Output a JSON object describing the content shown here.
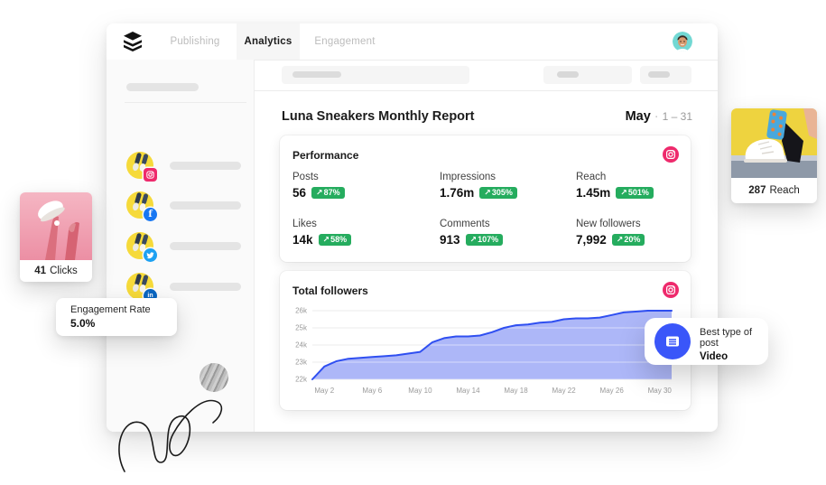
{
  "topbar": {
    "tabs": [
      {
        "label": "Publishing",
        "active": false
      },
      {
        "label": "Analytics",
        "active": true
      },
      {
        "label": "Engagement",
        "active": false
      }
    ]
  },
  "report_header": {
    "title": "Luna Sneakers Monthly Report",
    "month": "May",
    "separator": "·",
    "date_range": "1 – 31"
  },
  "performance_card": {
    "title": "Performance",
    "network": "instagram",
    "stats": [
      {
        "label": "Posts",
        "value": "56",
        "change": "87%"
      },
      {
        "label": "Impressions",
        "value": "1.76m",
        "change": "305%"
      },
      {
        "label": "Reach",
        "value": "1.45m",
        "change": "501%"
      },
      {
        "label": "Likes",
        "value": "14k",
        "change": "58%"
      },
      {
        "label": "Comments",
        "value": "913",
        "change": "107%"
      },
      {
        "label": "New followers",
        "value": "7,992",
        "change": "20%"
      }
    ]
  },
  "followers_card": {
    "title": "Total followers",
    "network": "instagram"
  },
  "chart_data": {
    "type": "area",
    "title": "Total followers",
    "x_unit": "day of May",
    "x": [
      1,
      2,
      3,
      4,
      5,
      6,
      7,
      8,
      9,
      10,
      11,
      12,
      13,
      14,
      15,
      16,
      17,
      18,
      19,
      20,
      21,
      22,
      23,
      24,
      25,
      26,
      27,
      28,
      29,
      30,
      31
    ],
    "values": [
      22000,
      22750,
      23050,
      23200,
      23250,
      23300,
      23350,
      23400,
      23500,
      23600,
      24150,
      24400,
      24500,
      24500,
      24550,
      24750,
      25000,
      25150,
      25200,
      25300,
      25350,
      25500,
      25550,
      25550,
      25600,
      25750,
      25900,
      25950,
      26000,
      26000,
      26000
    ],
    "ylim": [
      22000,
      26000
    ],
    "y_ticks": [
      {
        "value": 22000,
        "label": "22k"
      },
      {
        "value": 23000,
        "label": "23k"
      },
      {
        "value": 24000,
        "label": "24k"
      },
      {
        "value": 25000,
        "label": "25k"
      },
      {
        "value": 26000,
        "label": "26k"
      }
    ],
    "x_ticks": [
      {
        "day": 2,
        "label": "May 2"
      },
      {
        "day": 6,
        "label": "May 6"
      },
      {
        "day": 10,
        "label": "May 10"
      },
      {
        "day": 14,
        "label": "May 14"
      },
      {
        "day": 18,
        "label": "May 18"
      },
      {
        "day": 22,
        "label": "May 22"
      },
      {
        "day": 26,
        "label": "May 26"
      },
      {
        "day": 30,
        "label": "May 30"
      }
    ],
    "grid": "horizontal",
    "legend": "none",
    "line_color": "#2F4FF1",
    "fill_color": "#A9B3F8"
  },
  "floating": {
    "clicks": {
      "value": "41",
      "label": "Clicks"
    },
    "reach": {
      "value": "287",
      "label": "Reach"
    },
    "engagement_rate": {
      "label": "Engagement Rate",
      "value": "5.0%"
    },
    "best_post": {
      "label": "Best type of post",
      "value": "Video"
    }
  },
  "sidebar": {
    "networks": [
      "instagram",
      "facebook",
      "twitter",
      "linkedin"
    ]
  },
  "ui": {
    "trend_arrow": "↗",
    "colors": {
      "positive_badge": "#25AC5E",
      "instagram": "#EE2A6C",
      "facebook": "#1877F2",
      "twitter": "#1DA1F2",
      "linkedin": "#0A66C2",
      "best_post_icon": "#3A56F9",
      "avatar_bg": "#72D8D3",
      "profile_photo_bg": "#F6DA3A"
    }
  }
}
